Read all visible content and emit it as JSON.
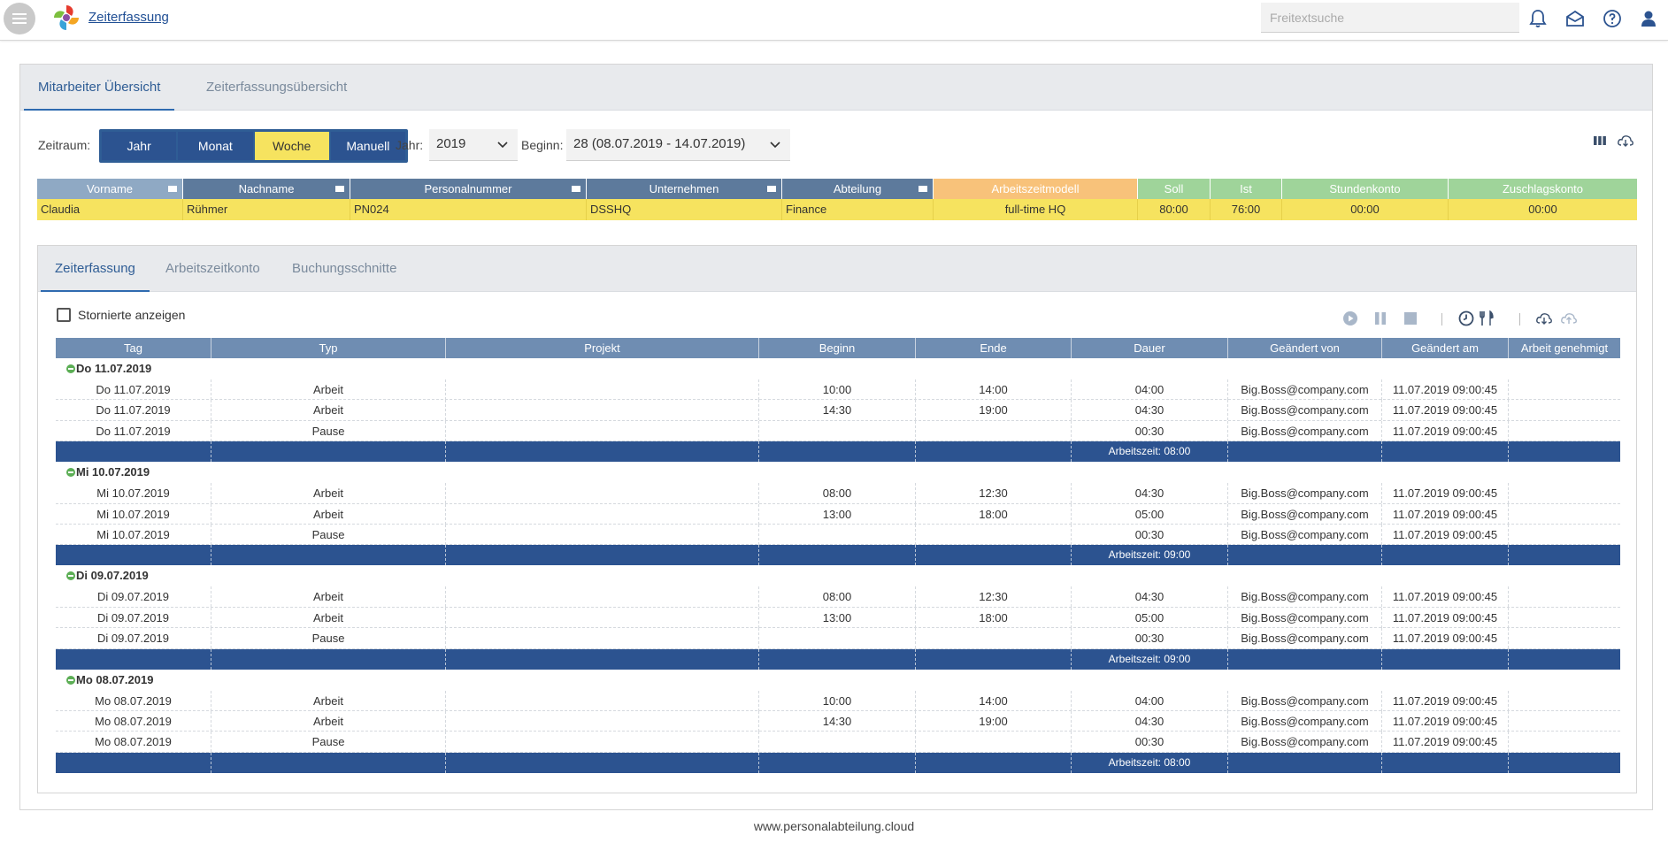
{
  "app": {
    "title": "Zeiterfassung"
  },
  "search": {
    "placeholder": "Freitextsuche"
  },
  "main_tabs": [
    "Mitarbeiter Übersicht",
    "Zeiterfassungsübersicht"
  ],
  "toolbar": {
    "zeitraum_label": "Zeitraum:",
    "period_buttons": [
      "Jahr",
      "Monat",
      "Woche",
      "Manuell"
    ],
    "selected_period": "Woche",
    "jahr_label": "Jahr:",
    "jahr_value": "2019",
    "beginn_label": "Beginn:",
    "beginn_value": "28 (08.07.2019 - 14.07.2019)"
  },
  "employee_grid": {
    "headers": [
      "Vorname",
      "Nachname",
      "Personalnummer",
      "Unternehmen",
      "Abteilung",
      "Arbeitszeitmodell",
      "Soll",
      "Ist",
      "Stundenkonto",
      "Zuschlagskonto"
    ],
    "row": [
      "Claudia",
      "Rühmer",
      "PN024",
      "DSSHQ",
      "Finance",
      "full-time HQ",
      "80:00",
      "76:00",
      "00:00",
      "00:00"
    ]
  },
  "inner_tabs": [
    "Zeiterfassung",
    "Arbeitszeitkonto",
    "Buchungsschnitte"
  ],
  "show_cancelled_label": "Stornierte anzeigen",
  "time_grid": {
    "headers": [
      "Tag",
      "Typ",
      "Projekt",
      "Beginn",
      "Ende",
      "Dauer",
      "Geändert von",
      "Geändert am",
      "Arbeit genehmigt"
    ],
    "groups": [
      {
        "title": "Do 11.07.2019",
        "rows": [
          [
            "Do 11.07.2019",
            "Arbeit",
            "",
            "10:00",
            "14:00",
            "04:00",
            "Big.Boss@company.com",
            "11.07.2019 09:00:45",
            ""
          ],
          [
            "Do 11.07.2019",
            "Arbeit",
            "",
            "14:30",
            "19:00",
            "04:30",
            "Big.Boss@company.com",
            "11.07.2019 09:00:45",
            ""
          ],
          [
            "Do 11.07.2019",
            "Pause",
            "",
            "",
            "",
            "00:30",
            "Big.Boss@company.com",
            "11.07.2019 09:00:45",
            ""
          ]
        ],
        "summary": "Arbeitszeit: 08:00"
      },
      {
        "title": "Mi 10.07.2019",
        "rows": [
          [
            "Mi 10.07.2019",
            "Arbeit",
            "",
            "08:00",
            "12:30",
            "04:30",
            "Big.Boss@company.com",
            "11.07.2019 09:00:45",
            ""
          ],
          [
            "Mi 10.07.2019",
            "Arbeit",
            "",
            "13:00",
            "18:00",
            "05:00",
            "Big.Boss@company.com",
            "11.07.2019 09:00:45",
            ""
          ],
          [
            "Mi 10.07.2019",
            "Pause",
            "",
            "",
            "",
            "00:30",
            "Big.Boss@company.com",
            "11.07.2019 09:00:45",
            ""
          ]
        ],
        "summary": "Arbeitszeit: 09:00"
      },
      {
        "title": "Di 09.07.2019",
        "rows": [
          [
            "Di 09.07.2019",
            "Arbeit",
            "",
            "08:00",
            "12:30",
            "04:30",
            "Big.Boss@company.com",
            "11.07.2019 09:00:45",
            ""
          ],
          [
            "Di 09.07.2019",
            "Arbeit",
            "",
            "13:00",
            "18:00",
            "05:00",
            "Big.Boss@company.com",
            "11.07.2019 09:00:45",
            ""
          ],
          [
            "Di 09.07.2019",
            "Pause",
            "",
            "",
            "",
            "00:30",
            "Big.Boss@company.com",
            "11.07.2019 09:00:45",
            ""
          ]
        ],
        "summary": "Arbeitszeit: 09:00"
      },
      {
        "title": "Mo 08.07.2019",
        "rows": [
          [
            "Mo 08.07.2019",
            "Arbeit",
            "",
            "10:00",
            "14:00",
            "04:00",
            "Big.Boss@company.com",
            "11.07.2019 09:00:45",
            ""
          ],
          [
            "Mo 08.07.2019",
            "Arbeit",
            "",
            "14:30",
            "19:00",
            "04:30",
            "Big.Boss@company.com",
            "11.07.2019 09:00:45",
            ""
          ],
          [
            "Mo 08.07.2019",
            "Pause",
            "",
            "",
            "",
            "00:30",
            "Big.Boss@company.com",
            "11.07.2019 09:00:45",
            ""
          ]
        ],
        "summary": "Arbeitszeit: 08:00"
      }
    ]
  },
  "footer": "www.personalabteilung.cloud",
  "colors": {
    "primary": "#2c5390",
    "highlight": "#f6e35f",
    "header_blue": "#6f8db2",
    "header_slate": "#5d7a9c",
    "header_orange": "#f8c27a",
    "header_green": "#9fd49a",
    "group_dot": "#5cae55"
  },
  "icons": [
    "menu-icon",
    "logo-icon",
    "bell-icon",
    "mail-icon",
    "help-icon",
    "user-icon",
    "columns-icon",
    "cloud-download-icon",
    "play-icon",
    "pause-icon",
    "stop-icon",
    "clock-icon",
    "cutlery-icon",
    "cloud-upload-icon"
  ]
}
